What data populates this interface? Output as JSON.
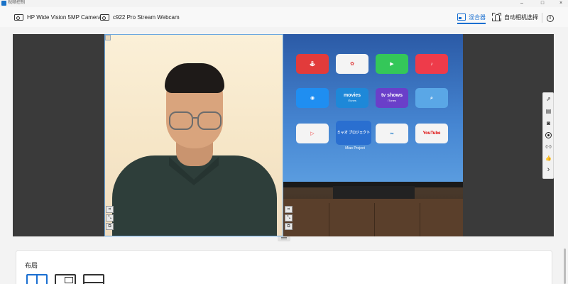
{
  "titlebar": {
    "app_name": "视频控制",
    "minimize": "–",
    "maximize": "□",
    "close": "×"
  },
  "toolbar": {
    "cameras": [
      {
        "label": "HP Wide Vision 5MP Camera"
      },
      {
        "label": "c922 Pro Stream Webcam"
      }
    ],
    "mode_mix_label": "混合器",
    "mode_auto_label": "自动相机选择",
    "info_glyph": "i"
  },
  "preview": {
    "tv_apps": [
      {
        "label": "movies",
        "sub": "iTunes"
      },
      {
        "label": "tv shows",
        "sub": "iTunes"
      },
      {
        "label": "YouTube",
        "sub": ""
      },
      {
        "label": "ミャオ プロジェクト",
        "sub": ""
      }
    ],
    "tv_app_caption": "Miao Project"
  },
  "side_tools": {
    "items": [
      {
        "icon": "share-icon",
        "glyph": "⇗"
      },
      {
        "icon": "save-icon",
        "glyph": "▤"
      },
      {
        "icon": "camera-icon",
        "glyph": "◙"
      },
      {
        "icon": "record-icon",
        "glyph": ""
      },
      {
        "icon": "broadcast-icon",
        "glyph": "((·))"
      },
      {
        "icon": "thumbs-up-icon",
        "glyph": "👍"
      },
      {
        "icon": "chevron-right-icon",
        "glyph": "›"
      }
    ]
  },
  "layout_panel": {
    "title": "布局"
  },
  "colors": {
    "accent": "#1a6fd1",
    "frame_border": "#6aa7e0"
  }
}
